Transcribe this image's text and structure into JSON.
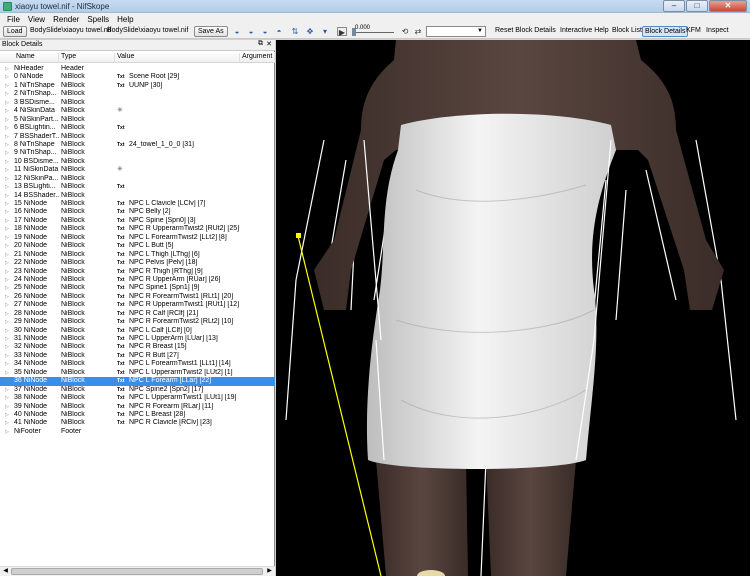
{
  "window": {
    "title": "xiaoyu towel.nif - NifSkope",
    "minimize": "–",
    "maximize": "□",
    "close": "✕"
  },
  "menu": [
    "File",
    "View",
    "Render",
    "Spells",
    "Help"
  ],
  "toolbar": {
    "load_label": "Load",
    "load_path": "BodySlide\\xiaoyu towel.nif",
    "save_path": "BodySlide\\xiaoyu towel.nif",
    "save_as_label": "Save As",
    "time_value": "0.000",
    "reset_label": "Reset Block Details",
    "interactive_help_label": "Interactive Help",
    "block_list_label": "Block List",
    "block_details_label": "Block Details",
    "kfm_label": "KFM",
    "inspect_label": "Inspect"
  },
  "panel": {
    "title": "Block Details",
    "columns": [
      "Name",
      "Type",
      "Value",
      "Argument"
    ],
    "rows": [
      {
        "name": "NiHeader",
        "type": "Header",
        "txt": "",
        "value": "",
        "icon": ""
      },
      {
        "name": "0 NiNode",
        "type": "NiBlock",
        "txt": "Txt",
        "value": "Scene Root [29]",
        "icon": ""
      },
      {
        "name": "1 NiTriShape",
        "type": "NiBlock",
        "txt": "Txt",
        "value": "UUNP [30]",
        "icon": ""
      },
      {
        "name": "2 NiTriShap...",
        "type": "NiBlock",
        "txt": "",
        "value": "",
        "icon": ""
      },
      {
        "name": "3 BSDisme...",
        "type": "NiBlock",
        "txt": "",
        "value": "",
        "icon": ""
      },
      {
        "name": "4 NiSkinData",
        "type": "NiBlock",
        "txt": "",
        "value": "",
        "icon": "✳"
      },
      {
        "name": "5 NiSkinPart...",
        "type": "NiBlock",
        "txt": "",
        "value": "",
        "icon": ""
      },
      {
        "name": "6 BSLightin...",
        "type": "NiBlock",
        "txt": "Txt",
        "value": "",
        "icon": ""
      },
      {
        "name": "7 BSShaderT...",
        "type": "NiBlock",
        "txt": "",
        "value": "",
        "icon": ""
      },
      {
        "name": "8 NiTriShape",
        "type": "NiBlock",
        "txt": "Txt",
        "value": "24_towel_1_0_0 [31]",
        "icon": ""
      },
      {
        "name": "9 NiTriShap...",
        "type": "NiBlock",
        "txt": "",
        "value": "",
        "icon": ""
      },
      {
        "name": "10 BSDisme...",
        "type": "NiBlock",
        "txt": "",
        "value": "",
        "icon": ""
      },
      {
        "name": "11 NiSkinData",
        "type": "NiBlock",
        "txt": "",
        "value": "",
        "icon": "✳"
      },
      {
        "name": "12 NiSkinPa...",
        "type": "NiBlock",
        "txt": "",
        "value": "",
        "icon": ""
      },
      {
        "name": "13 BSLighti...",
        "type": "NiBlock",
        "txt": "Txt",
        "value": "",
        "icon": ""
      },
      {
        "name": "14 BSShader...",
        "type": "NiBlock",
        "txt": "",
        "value": "",
        "icon": ""
      },
      {
        "name": "15 NiNode",
        "type": "NiBlock",
        "txt": "Txt",
        "value": "NPC L Clavicle [LClv] [7]",
        "icon": ""
      },
      {
        "name": "16 NiNode",
        "type": "NiBlock",
        "txt": "Txt",
        "value": "NPC Belly [2]",
        "icon": ""
      },
      {
        "name": "17 NiNode",
        "type": "NiBlock",
        "txt": "Txt",
        "value": "NPC Spine [Spn0] [3]",
        "icon": ""
      },
      {
        "name": "18 NiNode",
        "type": "NiBlock",
        "txt": "Txt",
        "value": "NPC R UpperarmTwist2 [RUt2] [25]",
        "icon": ""
      },
      {
        "name": "19 NiNode",
        "type": "NiBlock",
        "txt": "Txt",
        "value": "NPC L ForearmTwist2 [LLt2] [8]",
        "icon": ""
      },
      {
        "name": "20 NiNode",
        "type": "NiBlock",
        "txt": "Txt",
        "value": "NPC L Butt [5]",
        "icon": ""
      },
      {
        "name": "21 NiNode",
        "type": "NiBlock",
        "txt": "Txt",
        "value": "NPC L Thigh [LThg] [6]",
        "icon": ""
      },
      {
        "name": "22 NiNode",
        "type": "NiBlock",
        "txt": "Txt",
        "value": "NPC Pelvis [Pelv] [18]",
        "icon": ""
      },
      {
        "name": "23 NiNode",
        "type": "NiBlock",
        "txt": "Txt",
        "value": "NPC R Thigh [RThg] [9]",
        "icon": ""
      },
      {
        "name": "24 NiNode",
        "type": "NiBlock",
        "txt": "Txt",
        "value": "NPC R UpperArm [RUar] [26]",
        "icon": ""
      },
      {
        "name": "25 NiNode",
        "type": "NiBlock",
        "txt": "Txt",
        "value": "NPC Spine1 [Spn1] [9]",
        "icon": ""
      },
      {
        "name": "26 NiNode",
        "type": "NiBlock",
        "txt": "Txt",
        "value": "NPC R ForearmTwist1 [RLt1] [20]",
        "icon": ""
      },
      {
        "name": "27 NiNode",
        "type": "NiBlock",
        "txt": "Txt",
        "value": "NPC R UpperarmTwist1 [RUt1] [12]",
        "icon": ""
      },
      {
        "name": "28 NiNode",
        "type": "NiBlock",
        "txt": "Txt",
        "value": "NPC R Calf [RClf] [21]",
        "icon": ""
      },
      {
        "name": "29 NiNode",
        "type": "NiBlock",
        "txt": "Txt",
        "value": "NPC R ForearmTwist2 [RLt2] [10]",
        "icon": ""
      },
      {
        "name": "30 NiNode",
        "type": "NiBlock",
        "txt": "Txt",
        "value": "NPC L Calf [LClf] [0]",
        "icon": ""
      },
      {
        "name": "31 NiNode",
        "type": "NiBlock",
        "txt": "Txt",
        "value": "NPC L UpperArm [LUar] [13]",
        "icon": ""
      },
      {
        "name": "32 NiNode",
        "type": "NiBlock",
        "txt": "Txt",
        "value": "NPC R Breast [15]",
        "icon": ""
      },
      {
        "name": "33 NiNode",
        "type": "NiBlock",
        "txt": "Txt",
        "value": "NPC R Butt [27]",
        "icon": ""
      },
      {
        "name": "34 NiNode",
        "type": "NiBlock",
        "txt": "Txt",
        "value": "NPC L ForearmTwist1 [LLt1] [14]",
        "icon": ""
      },
      {
        "name": "35 NiNode",
        "type": "NiBlock",
        "txt": "Txt",
        "value": "NPC L UpperarmTwist2 [LUt2] [1]",
        "icon": ""
      },
      {
        "name": "36 NiNode",
        "type": "NiBlock",
        "txt": "Txt",
        "value": "NPC L Forearm [LLar] [22]",
        "icon": "",
        "selected": true
      },
      {
        "name": "37 NiNode",
        "type": "NiBlock",
        "txt": "Txt",
        "value": "NPC Spine2 [Spn2] [17]",
        "icon": ""
      },
      {
        "name": "38 NiNode",
        "type": "NiBlock",
        "txt": "Txt",
        "value": "NPC L UpperarmTwist1 [LUt1] [19]",
        "icon": ""
      },
      {
        "name": "39 NiNode",
        "type": "NiBlock",
        "txt": "Txt",
        "value": "NPC R Forearm [RLar] [11]",
        "icon": ""
      },
      {
        "name": "40 NiNode",
        "type": "NiBlock",
        "txt": "Txt",
        "value": "NPC L Breast [28]",
        "icon": ""
      },
      {
        "name": "41 NiNode",
        "type": "NiBlock",
        "txt": "Txt",
        "value": "NPC R Clavicle [RClv] [23]",
        "icon": ""
      },
      {
        "name": "NiFooter",
        "type": "Footer",
        "txt": "",
        "value": "",
        "icon": ""
      }
    ]
  },
  "colors": {
    "selection": "#3a8ee6",
    "viewport_bg": "#000000",
    "skin": "#4e3d38",
    "towel": "#e6e6e6",
    "bone_line": "#ffffff",
    "selected_bone": "#ffff00"
  }
}
